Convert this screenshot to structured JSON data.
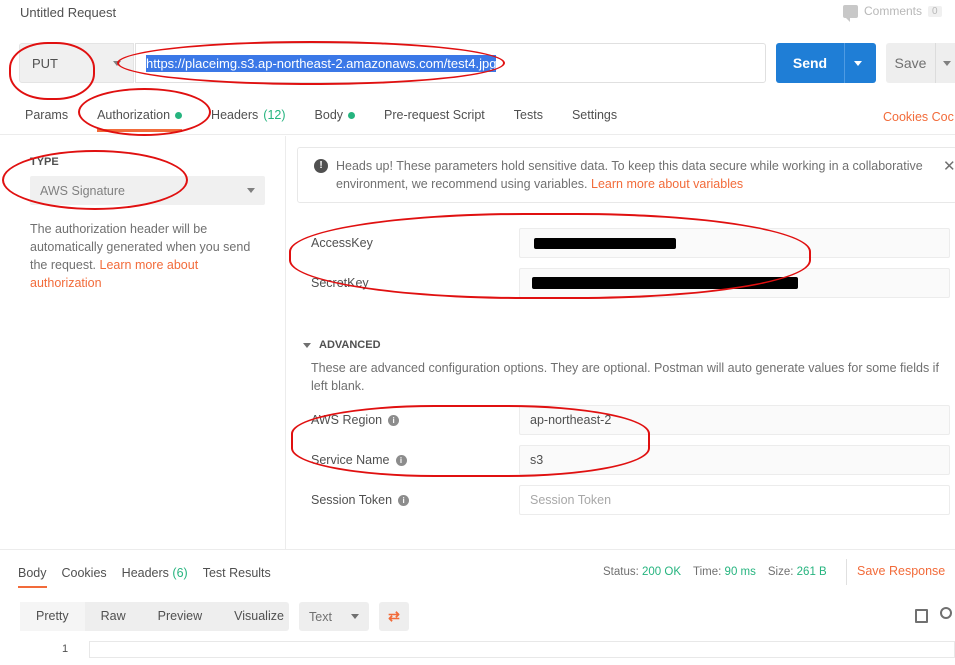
{
  "header": {
    "title": "Untitled Request",
    "comments_label": "Comments",
    "comments_count": "0"
  },
  "request": {
    "method": "PUT",
    "url": "https://placeimg.s3.ap-northeast-2.amazonaws.com/test4.jpg",
    "send_label": "Send",
    "save_label": "Save"
  },
  "tabs": [
    {
      "label": "Params"
    },
    {
      "label": "Authorization",
      "dot": true
    },
    {
      "label": "Headers",
      "count": "(12)"
    },
    {
      "label": "Body",
      "dot": true
    },
    {
      "label": "Pre-request Script"
    },
    {
      "label": "Tests"
    },
    {
      "label": "Settings"
    }
  ],
  "cookies_link": "Cookies  Coc",
  "auth": {
    "type_label": "TYPE",
    "type_value": "AWS Signature",
    "desc": "The authorization header will be automatically generated when you send the request.",
    "desc_link": "Learn more about authorization"
  },
  "warning": {
    "text": "Heads up! These parameters hold sensitive data. To keep this data secure while working in a collaborative environment, we recommend using variables.",
    "link": "Learn more about variables"
  },
  "fields": {
    "access_key": {
      "label": "AccessKey"
    },
    "secret_key": {
      "label": "SecretKey"
    },
    "advanced_label": "ADVANCED",
    "advanced_desc": "These are advanced configuration options. They are optional. Postman will auto generate values for some fields if left blank.",
    "region": {
      "label": "AWS Region",
      "value": "ap-northeast-2"
    },
    "service": {
      "label": "Service Name",
      "value": "s3"
    },
    "session": {
      "label": "Session Token",
      "placeholder": "Session Token"
    }
  },
  "response": {
    "tabs": [
      {
        "label": "Body"
      },
      {
        "label": "Cookies"
      },
      {
        "label": "Headers",
        "count": "(6)"
      },
      {
        "label": "Test Results"
      }
    ],
    "status_label": "Status:",
    "status_value": "200 OK",
    "time_label": "Time:",
    "time_value": "90 ms",
    "size_label": "Size:",
    "size_value": "261 B",
    "save_response": "Save Response",
    "views": [
      "Pretty",
      "Raw",
      "Preview",
      "Visualize"
    ],
    "format": "Text",
    "line_number": "1"
  },
  "colors": {
    "accent": "#f26b3a",
    "send": "#1f7ed6",
    "success": "#26b47f",
    "annotation": "#e01010"
  }
}
